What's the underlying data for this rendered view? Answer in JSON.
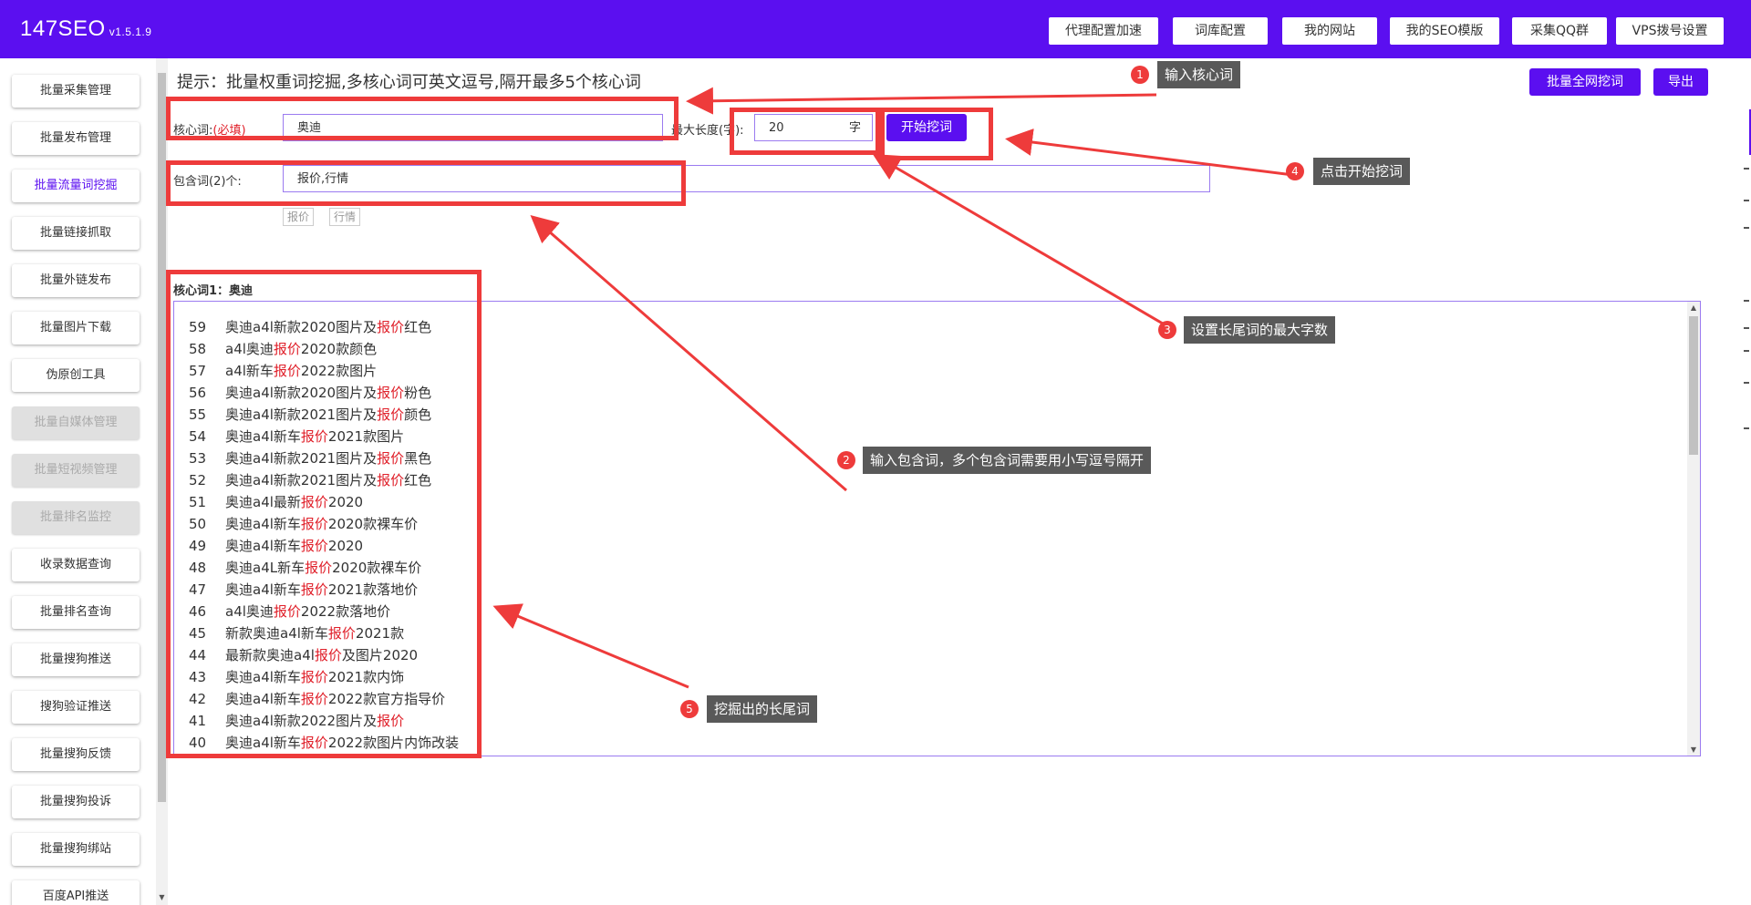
{
  "app": {
    "name": "147SEO",
    "version": "v1.5.1.9"
  },
  "topnav": [
    "代理配置加速",
    "词库配置",
    "我的网站",
    "我的SEO模版",
    "采集QQ群",
    "VPS拨号设置"
  ],
  "sidebar": [
    {
      "label": "批量采集管理",
      "state": "normal"
    },
    {
      "label": "批量发布管理",
      "state": "normal"
    },
    {
      "label": "批量流量词挖掘",
      "state": "active"
    },
    {
      "label": "批量链接抓取",
      "state": "normal"
    },
    {
      "label": "批量外链发布",
      "state": "normal"
    },
    {
      "label": "批量图片下载",
      "state": "normal"
    },
    {
      "label": "伪原创工具",
      "state": "normal"
    },
    {
      "label": "批量自媒体管理",
      "state": "disabled"
    },
    {
      "label": "批量短视频管理",
      "state": "disabled"
    },
    {
      "label": "批量排名监控",
      "state": "disabled"
    },
    {
      "label": "收录数据查询",
      "state": "normal"
    },
    {
      "label": "批量排名查询",
      "state": "normal"
    },
    {
      "label": "批量搜狗推送",
      "state": "normal"
    },
    {
      "label": "搜狗验证推送",
      "state": "normal"
    },
    {
      "label": "批量搜狗反馈",
      "state": "normal"
    },
    {
      "label": "批量搜狗投诉",
      "state": "normal"
    },
    {
      "label": "批量搜狗绑站",
      "state": "normal"
    },
    {
      "label": "百度API推送",
      "state": "normal"
    }
  ],
  "main": {
    "hint": "提示：批量权重词挖掘,多核心词可英文逗号,隔开最多5个核心词",
    "btn_all": "批量全网挖词",
    "btn_export": "导出",
    "core_label": "核心词:",
    "core_required": "(必填)",
    "core_value": "奥迪",
    "maxlen_label": "最大长度(字):",
    "maxlen_value": "20",
    "maxlen_unit": "字",
    "btn_start": "开始挖词",
    "include_label": "包含词(2)个:",
    "include_value": "报价,行情",
    "include_tags": [
      "报价",
      "行情"
    ],
    "result_title": "核心词1：奥迪",
    "results": [
      {
        "n": "59",
        "pre": "奥迪a4l新款2020图片及",
        "hl": "报价",
        "post": "红色"
      },
      {
        "n": "58",
        "pre": "a4l奥迪",
        "hl": "报价",
        "post": "2020款颜色"
      },
      {
        "n": "57",
        "pre": "a4l新车",
        "hl": "报价",
        "post": "2022款图片"
      },
      {
        "n": "56",
        "pre": "奥迪a4l新款2020图片及",
        "hl": "报价",
        "post": "粉色"
      },
      {
        "n": "55",
        "pre": "奥迪a4l新款2021图片及",
        "hl": "报价",
        "post": "颜色"
      },
      {
        "n": "54",
        "pre": "奥迪a4l新车",
        "hl": "报价",
        "post": "2021款图片"
      },
      {
        "n": "53",
        "pre": "奥迪a4l新款2021图片及",
        "hl": "报价",
        "post": "黑色"
      },
      {
        "n": "52",
        "pre": "奥迪a4l新款2021图片及",
        "hl": "报价",
        "post": "红色"
      },
      {
        "n": "51",
        "pre": "奥迪a4l最新",
        "hl": "报价",
        "post": "2020"
      },
      {
        "n": "50",
        "pre": "奥迪a4l新车",
        "hl": "报价",
        "post": "2020款裸车价"
      },
      {
        "n": "49",
        "pre": "奥迪a4l新车",
        "hl": "报价",
        "post": "2020"
      },
      {
        "n": "48",
        "pre": "奥迪a4L新车",
        "hl": "报价",
        "post": "2020款裸车价"
      },
      {
        "n": "47",
        "pre": "奥迪a4l新车",
        "hl": "报价",
        "post": "2021款落地价"
      },
      {
        "n": "46",
        "pre": "a4l奥迪",
        "hl": "报价",
        "post": "2022款落地价"
      },
      {
        "n": "45",
        "pre": "新款奥迪a4l新车",
        "hl": "报价",
        "post": "2021款"
      },
      {
        "n": "44",
        "pre": "最新款奥迪a4l",
        "hl": "报价",
        "post": "及图片2020"
      },
      {
        "n": "43",
        "pre": "奥迪a4l新车",
        "hl": "报价",
        "post": "2021款内饰"
      },
      {
        "n": "42",
        "pre": "奥迪a4l新车",
        "hl": "报价",
        "post": "2022款官方指导价"
      },
      {
        "n": "41",
        "pre": "奥迪a4l新款2022图片及",
        "hl": "报价",
        "post": ""
      },
      {
        "n": "40",
        "pre": "奥迪a4l新车",
        "hl": "报价",
        "post": "2022款图片内饰改装"
      }
    ]
  },
  "annotations": [
    {
      "n": "1",
      "text": "输入核心词"
    },
    {
      "n": "2",
      "text": "输入包含词，多个包含词需要用小写逗号隔开"
    },
    {
      "n": "3",
      "text": "设置长尾词的最大字数"
    },
    {
      "n": "4",
      "text": "点击开始挖词"
    },
    {
      "n": "5",
      "text": "挖掘出的长尾词"
    }
  ],
  "colors": {
    "brand": "#5b0ff0",
    "highlight": "#ee3b3b",
    "callout_bg": "#595959"
  }
}
